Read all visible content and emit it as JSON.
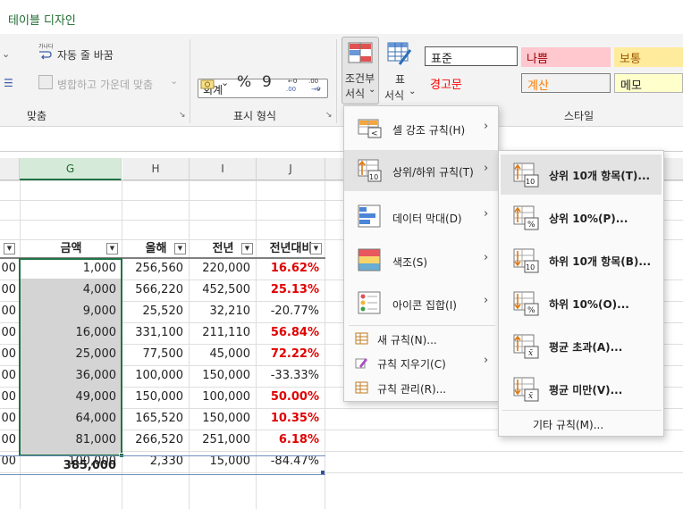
{
  "ribbon": {
    "active_tab": "테이블 디자인",
    "alignment": {
      "wrap_text": "자동 줄 바꿈",
      "wrap_icon_caption": "가나다",
      "merge_center": "병합하고 가운데 맞춤",
      "group_label": "맞춤"
    },
    "number": {
      "format_value": "회계",
      "percent_symbol": "%",
      "comma_symbol": "9",
      "group_label": "표시 형식"
    },
    "styles": {
      "conditional_formatting_line1": "조건부",
      "conditional_formatting_line2": "서식",
      "format_as_table_line1": "표",
      "format_as_table_line2": "서식",
      "cells": [
        {
          "label": "표준",
          "bg": "#ffffff",
          "color": "#222222"
        },
        {
          "label": "나쁨",
          "bg": "#ffc7ce",
          "color": "#9c0006"
        },
        {
          "label": "보통",
          "bg": "#ffeb9c",
          "color": "#9c5700"
        },
        {
          "label": "경고문",
          "bg": "#f3f3f3",
          "color": "#ff0000"
        },
        {
          "label": "계산",
          "bg": "#f2f2f2",
          "color": "#fa7d00"
        },
        {
          "label": "메모",
          "bg": "#ffffcc",
          "color": "#222222"
        }
      ],
      "group_label": "스타일"
    }
  },
  "sheet": {
    "columns": [
      "G",
      "H",
      "I",
      "J"
    ],
    "selected_column": "G",
    "headers": {
      "g": "금액",
      "h": "올해",
      "i": "전년",
      "j": "전년대비"
    },
    "left_col_values": [
      "00",
      "00",
      "00",
      "00",
      "00",
      "00",
      "00",
      "00",
      "00",
      "00"
    ],
    "rows": [
      {
        "g": "1,000",
        "h": "256,560",
        "i": "220,000",
        "j": "16.62%",
        "j_red": true
      },
      {
        "g": "4,000",
        "h": "566,220",
        "i": "452,500",
        "j": "25.13%",
        "j_red": true
      },
      {
        "g": "9,000",
        "h": "25,520",
        "i": "32,210",
        "j": "-20.77%",
        "j_red": false
      },
      {
        "g": "16,000",
        "h": "331,100",
        "i": "211,110",
        "j": "56.84%",
        "j_red": true
      },
      {
        "g": "25,000",
        "h": "77,500",
        "i": "45,000",
        "j": "72.22%",
        "j_red": true
      },
      {
        "g": "36,000",
        "h": "100,000",
        "i": "150,000",
        "j": "-33.33%",
        "j_red": false
      },
      {
        "g": "49,000",
        "h": "150,000",
        "i": "100,000",
        "j": "50.00%",
        "j_red": true
      },
      {
        "g": "64,000",
        "h": "165,520",
        "i": "150,000",
        "j": "10.35%",
        "j_red": true
      },
      {
        "g": "81,000",
        "h": "266,520",
        "i": "251,000",
        "j": "6.18%",
        "j_red": true
      },
      {
        "g": "100,000",
        "h": "2,330",
        "i": "15,000",
        "j": "-84.47%",
        "j_red": false
      }
    ],
    "total": "385,000"
  },
  "cf_menu": {
    "items": [
      {
        "label": "셀 강조 규칙(H)",
        "has_submenu": true,
        "icon": "highlight-cells-rules-icon"
      },
      {
        "label": "상위/하위 규칙(T)",
        "has_submenu": true,
        "icon": "top-bottom-rules-icon",
        "hover": true
      },
      {
        "label": "데이터 막대(D)",
        "has_submenu": true,
        "icon": "data-bars-icon"
      },
      {
        "label": "색조(S)",
        "has_submenu": true,
        "icon": "color-scales-icon"
      },
      {
        "label": "아이콘 집합(I)",
        "has_submenu": true,
        "icon": "icon-sets-icon"
      }
    ],
    "small_items": [
      {
        "label": "새 규칙(N)...",
        "has_submenu": false,
        "icon": "new-rule-icon"
      },
      {
        "label": "규칙 지우기(C)",
        "has_submenu": true,
        "icon": "clear-rules-icon"
      },
      {
        "label": "규칙 관리(R)...",
        "has_submenu": false,
        "icon": "manage-rules-icon"
      }
    ]
  },
  "submenu": {
    "items": [
      {
        "label": "상위 10개 항목(T)...",
        "icon": "top-10-items-icon",
        "badge": "10",
        "hover": true
      },
      {
        "label": "상위 10%(P)...",
        "icon": "top-10-percent-icon",
        "badge": "%"
      },
      {
        "label": "하위 10개 항목(B)...",
        "icon": "bottom-10-items-icon",
        "badge": "10"
      },
      {
        "label": "하위 10%(O)...",
        "icon": "bottom-10-percent-icon",
        "badge": "%"
      },
      {
        "label": "평균 초과(A)...",
        "icon": "above-average-icon",
        "badge": "x̄"
      },
      {
        "label": "평균 미만(V)...",
        "icon": "below-average-icon",
        "badge": "x̄"
      }
    ],
    "more_rules": "기타 규칙(M)..."
  },
  "colors": {
    "accent_green": "#217346",
    "red_text": "#e00000",
    "selection_gray": "#d4d4d4"
  }
}
